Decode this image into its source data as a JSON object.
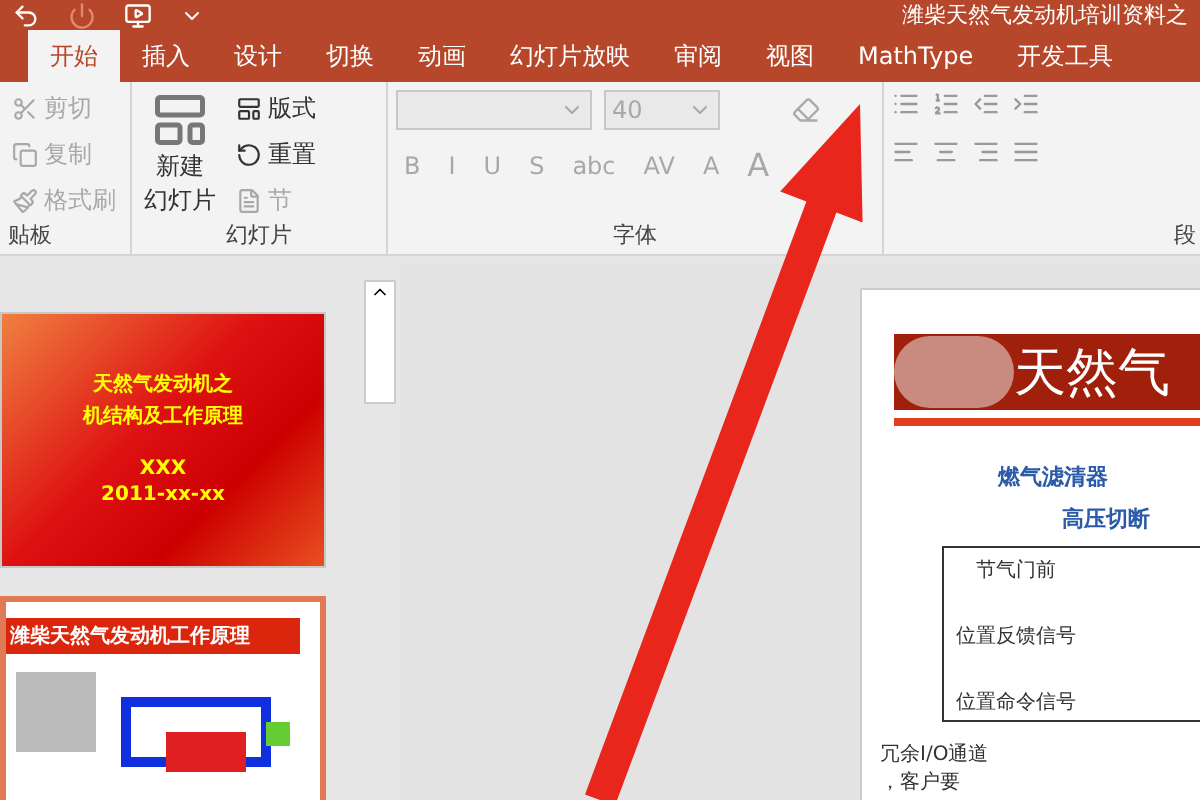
{
  "window": {
    "title": "潍柴天然气发动机培训资料之"
  },
  "tabs": [
    {
      "label": "开始",
      "selected": true
    },
    {
      "label": "插入",
      "selected": false
    },
    {
      "label": "设计",
      "selected": false
    },
    {
      "label": "切换",
      "selected": false
    },
    {
      "label": "动画",
      "selected": false
    },
    {
      "label": "幻灯片放映",
      "selected": false
    },
    {
      "label": "审阅",
      "selected": false
    },
    {
      "label": "视图",
      "selected": false
    },
    {
      "label": "MathType",
      "selected": false
    },
    {
      "label": "开发工具",
      "selected": false
    }
  ],
  "clipboard": {
    "label": "贴板",
    "items": [
      {
        "kind": "cut",
        "label": "剪切",
        "disabled": true
      },
      {
        "kind": "copy",
        "label": "复制",
        "disabled": true
      },
      {
        "kind": "format",
        "label": "格式刷",
        "disabled": true
      }
    ]
  },
  "slides_group": {
    "label": "幻灯片",
    "new_slide": [
      "新建",
      "幻灯片"
    ],
    "items": [
      {
        "kind": "layout",
        "label": "版式",
        "disabled": false
      },
      {
        "kind": "reset",
        "label": "重置",
        "disabled": false
      },
      {
        "kind": "section",
        "label": "节",
        "disabled": true
      }
    ]
  },
  "font_group": {
    "label": "字体",
    "font_size": "40",
    "buttons": [
      "B",
      "I",
      "U",
      "S",
      "abc",
      "AV",
      "A"
    ],
    "color_button": "A"
  },
  "paragraph_group": {
    "label": "段"
  },
  "thumbnails": [
    {
      "kind": "title",
      "selected": false,
      "lines": [
        "天然气发动机之",
        "机结构及工作原理"
      ],
      "author": "XXX",
      "date": "2011-xx-xx"
    },
    {
      "kind": "diagram",
      "selected": true,
      "lines": [
        "潍柴天然气发动机工作原理"
      ]
    }
  ],
  "slide": {
    "title": "天然气",
    "labels": [
      "燃气滤清器",
      "高压切断"
    ],
    "box_title": "节气门前",
    "signals": [
      "位置反馈信号",
      "位置命令信号"
    ],
    "left_labels": [
      "冗余I/O通道",
      "，客户要"
    ]
  }
}
